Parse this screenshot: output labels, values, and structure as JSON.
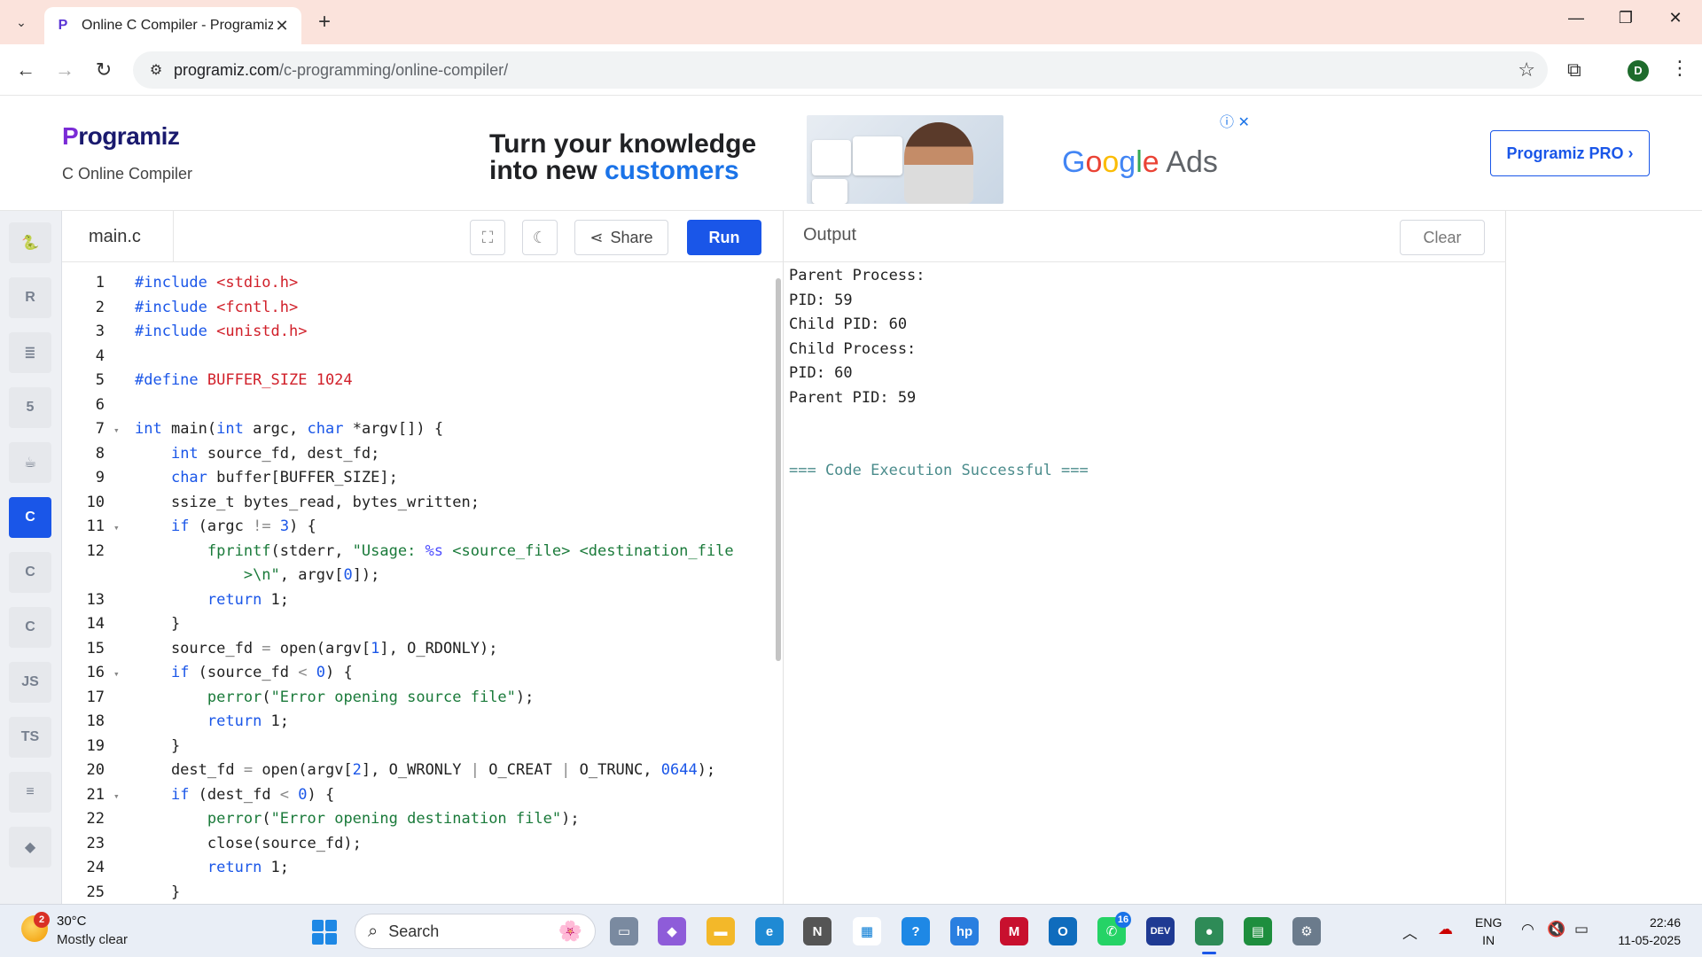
{
  "browser": {
    "tab_title": "Online C Compiler - Programiz",
    "tab_close": "✕",
    "new_tab": "+",
    "url_domain": "programiz.com",
    "url_path": "/c-programming/online-compiler/",
    "profile_initial": "D"
  },
  "header": {
    "logo_text": "rogramiz",
    "logo_p": "P",
    "subtitle": "C Online Compiler",
    "ad_line1": "Turn your knowledge",
    "ad_line2_a": "into new ",
    "ad_line2_b": "customers",
    "ad_brand_rest": " Ads",
    "pro_button": "Programiz PRO ›"
  },
  "sidebar": {
    "languages": [
      {
        "name": "python",
        "glyph": "🐍"
      },
      {
        "name": "r",
        "glyph": "R"
      },
      {
        "name": "sql",
        "glyph": "≣"
      },
      {
        "name": "html",
        "glyph": "5"
      },
      {
        "name": "java",
        "glyph": "☕"
      },
      {
        "name": "c",
        "glyph": "C",
        "active": true
      },
      {
        "name": "cpp",
        "glyph": "C"
      },
      {
        "name": "csharp",
        "glyph": "C"
      },
      {
        "name": "js",
        "glyph": "JS"
      },
      {
        "name": "ts",
        "glyph": "TS"
      },
      {
        "name": "go",
        "glyph": "≡"
      },
      {
        "name": "php",
        "glyph": "◆"
      }
    ]
  },
  "editor": {
    "file_name": "main.c",
    "share_label": "Share",
    "run_label": "Run",
    "lines": [
      {
        "n": "1",
        "fold": "",
        "code": [
          [
            "#include ",
            "#1a56e8"
          ],
          [
            "<stdio.h>",
            "#d1202a"
          ]
        ]
      },
      {
        "n": "2",
        "fold": "",
        "code": [
          [
            "#include ",
            "#1a56e8"
          ],
          [
            "<fcntl.h>",
            "#d1202a"
          ]
        ]
      },
      {
        "n": "3",
        "fold": "",
        "code": [
          [
            "#include ",
            "#1a56e8"
          ],
          [
            "<unistd.h>",
            "#d1202a"
          ]
        ]
      },
      {
        "n": "4",
        "fold": "",
        "code": []
      },
      {
        "n": "5",
        "fold": "",
        "code": [
          [
            "#define ",
            "#1a56e8"
          ],
          [
            "BUFFER_SIZE 1024",
            "#d1202a"
          ]
        ]
      },
      {
        "n": "6",
        "fold": "",
        "code": []
      },
      {
        "n": "7",
        "fold": "▾",
        "code": [
          [
            "int",
            "#1a56e8"
          ],
          [
            " main(",
            "#222"
          ],
          [
            "int",
            "#1a56e8"
          ],
          [
            " argc, ",
            "#222"
          ],
          [
            "char",
            "#1a56e8"
          ],
          [
            " *argv[]) {",
            "#222"
          ]
        ]
      },
      {
        "n": "8",
        "fold": "",
        "code": [
          [
            "    ",
            "#222"
          ],
          [
            "int",
            "#1a56e8"
          ],
          [
            " source_fd, dest_fd;",
            "#222"
          ]
        ]
      },
      {
        "n": "9",
        "fold": "",
        "code": [
          [
            "    ",
            "#222"
          ],
          [
            "char",
            "#1a56e8"
          ],
          [
            " buffer[BUFFER_SIZE];",
            "#222"
          ]
        ]
      },
      {
        "n": "10",
        "fold": "",
        "code": [
          [
            "    ssize_t bytes_read, bytes_written;",
            "#222"
          ]
        ]
      },
      {
        "n": "11",
        "fold": "▾",
        "code": [
          [
            "    ",
            "#222"
          ],
          [
            "if",
            "#1a56e8"
          ],
          [
            " (argc ",
            "#222"
          ],
          [
            "!=",
            "#888"
          ],
          [
            " ",
            "#222"
          ],
          [
            "3",
            "#1a56e8"
          ],
          [
            ") {",
            "#222"
          ]
        ]
      },
      {
        "n": "12",
        "fold": "",
        "code": [
          [
            "        ",
            "#222"
          ],
          [
            "fprintf",
            "#1a7a3a"
          ],
          [
            "(stderr, ",
            "#222"
          ],
          [
            "\"Usage: ",
            "#1a7a3a"
          ],
          [
            "%s",
            "#4d4dff"
          ],
          [
            " <source_file> <destination_file",
            "#1a7a3a"
          ]
        ]
      },
      {
        "n": "",
        "fold": "",
        "code": [
          [
            "            ",
            "#222"
          ],
          [
            ">\\n\"",
            "#1a7a3a"
          ],
          [
            ", argv[",
            "#222"
          ],
          [
            "0",
            "#1a56e8"
          ],
          [
            "]);",
            "#222"
          ]
        ]
      },
      {
        "n": "13",
        "fold": "",
        "code": [
          [
            "        ",
            "#222"
          ],
          [
            "return",
            "#1a56e8"
          ],
          [
            " 1;",
            "#222"
          ]
        ]
      },
      {
        "n": "14",
        "fold": "",
        "code": [
          [
            "    }",
            "#222"
          ]
        ]
      },
      {
        "n": "15",
        "fold": "",
        "code": [
          [
            "    source_fd ",
            "#222"
          ],
          [
            "=",
            "#888"
          ],
          [
            " open(argv[",
            "#222"
          ],
          [
            "1",
            "#1a56e8"
          ],
          [
            "], O_RDONLY);",
            "#222"
          ]
        ]
      },
      {
        "n": "16",
        "fold": "▾",
        "code": [
          [
            "    ",
            "#222"
          ],
          [
            "if",
            "#1a56e8"
          ],
          [
            " (source_fd ",
            "#222"
          ],
          [
            "<",
            "#888"
          ],
          [
            " ",
            "#222"
          ],
          [
            "0",
            "#1a56e8"
          ],
          [
            ") {",
            "#222"
          ]
        ]
      },
      {
        "n": "17",
        "fold": "",
        "code": [
          [
            "        ",
            "#222"
          ],
          [
            "perror",
            "#1a7a3a"
          ],
          [
            "(",
            "#222"
          ],
          [
            "\"Error opening source file\"",
            "#1a7a3a"
          ],
          [
            ");",
            "#222"
          ]
        ]
      },
      {
        "n": "18",
        "fold": "",
        "code": [
          [
            "        ",
            "#222"
          ],
          [
            "return",
            "#1a56e8"
          ],
          [
            " 1;",
            "#222"
          ]
        ]
      },
      {
        "n": "19",
        "fold": "",
        "code": [
          [
            "    }",
            "#222"
          ]
        ]
      },
      {
        "n": "20",
        "fold": "",
        "code": [
          [
            "    dest_fd ",
            "#222"
          ],
          [
            "=",
            "#888"
          ],
          [
            " open(argv[",
            "#222"
          ],
          [
            "2",
            "#1a56e8"
          ],
          [
            "], O_WRONLY ",
            "#222"
          ],
          [
            "|",
            "#888"
          ],
          [
            " O_CREAT ",
            "#222"
          ],
          [
            "|",
            "#888"
          ],
          [
            " O_TRUNC, ",
            "#222"
          ],
          [
            "0644",
            "#1a56e8"
          ],
          [
            ");",
            "#222"
          ]
        ]
      },
      {
        "n": "21",
        "fold": "▾",
        "code": [
          [
            "    ",
            "#222"
          ],
          [
            "if",
            "#1a56e8"
          ],
          [
            " (dest_fd ",
            "#222"
          ],
          [
            "<",
            "#888"
          ],
          [
            " ",
            "#222"
          ],
          [
            "0",
            "#1a56e8"
          ],
          [
            ") {",
            "#222"
          ]
        ]
      },
      {
        "n": "22",
        "fold": "",
        "code": [
          [
            "        ",
            "#222"
          ],
          [
            "perror",
            "#1a7a3a"
          ],
          [
            "(",
            "#222"
          ],
          [
            "\"Error opening destination file\"",
            "#1a7a3a"
          ],
          [
            ");",
            "#222"
          ]
        ]
      },
      {
        "n": "23",
        "fold": "",
        "code": [
          [
            "        close(source_fd);",
            "#222"
          ]
        ]
      },
      {
        "n": "24",
        "fold": "",
        "code": [
          [
            "        ",
            "#222"
          ],
          [
            "return",
            "#1a56e8"
          ],
          [
            " 1;",
            "#222"
          ]
        ]
      },
      {
        "n": "25",
        "fold": "",
        "code": [
          [
            "    }",
            "#222"
          ]
        ]
      }
    ]
  },
  "output": {
    "title": "Output",
    "clear_label": "Clear",
    "lines": [
      "Parent Process:",
      "PID: 59",
      "Child PID: 60",
      "Child Process:",
      "PID: 60",
      "Parent PID: 59",
      "",
      ""
    ],
    "success": "=== Code Execution Successful ==="
  },
  "taskbar": {
    "weather_badge": "2",
    "weather_temp": "30°C",
    "weather_desc": "Mostly clear",
    "search_label": "Search",
    "apps": [
      {
        "name": "task-view",
        "glyph": "▭",
        "bg": "#7a8aa0"
      },
      {
        "name": "copilot",
        "glyph": "◆",
        "bg": "#8e5cd9"
      },
      {
        "name": "file-explorer",
        "glyph": "▬",
        "bg": "#f3b829"
      },
      {
        "name": "edge",
        "glyph": "e",
        "bg": "#1f8ad4"
      },
      {
        "name": "notion",
        "glyph": "N",
        "bg": "#555555"
      },
      {
        "name": "store",
        "glyph": "▦",
        "bg": "#ffffff"
      },
      {
        "name": "help",
        "glyph": "?",
        "bg": "#1e88e5"
      },
      {
        "name": "myhp",
        "glyph": "hp",
        "bg": "#2a7fe0"
      },
      {
        "name": "mcafee",
        "glyph": "M",
        "bg": "#c8102e"
      },
      {
        "name": "outlook",
        "glyph": "O",
        "bg": "#0f6cbd"
      },
      {
        "name": "whatsapp",
        "glyph": "✆",
        "bg": "#25d366",
        "badge": "16"
      },
      {
        "name": "dev-cpp",
        "glyph": "DEV",
        "bg": "#1f3a93"
      },
      {
        "name": "chrome",
        "glyph": "●",
        "bg": "#2e8b57",
        "active": true
      },
      {
        "name": "classroom",
        "glyph": "▤",
        "bg": "#1e8e3e"
      },
      {
        "name": "settings",
        "glyph": "⚙",
        "bg": "#6b7b8c"
      }
    ],
    "lang_top": "ENG",
    "lang_bottom": "IN",
    "time": "22:46",
    "date": "11-05-2025"
  }
}
